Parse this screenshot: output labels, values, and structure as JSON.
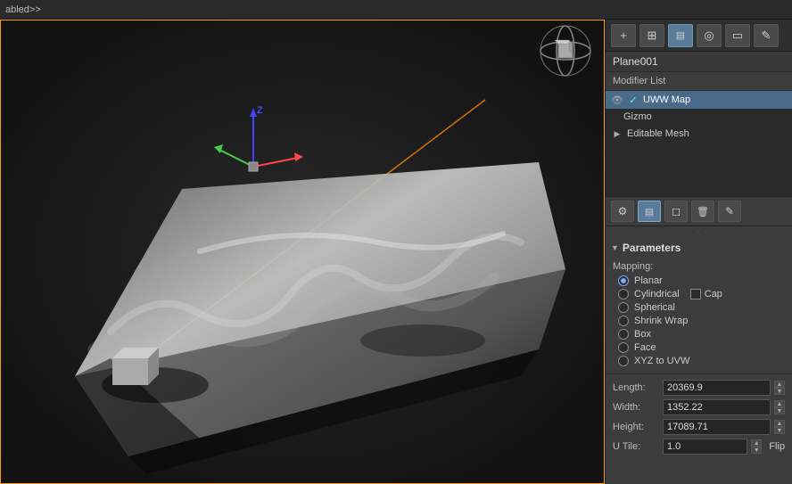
{
  "topbar": {
    "text": "abled>>"
  },
  "viewport": {
    "label": ""
  },
  "rightpanel": {
    "toolbar": {
      "plus_label": "+",
      "buttons": [
        {
          "icon": "⊞",
          "label": "modifier-list-icon",
          "active": false
        },
        {
          "icon": "▤",
          "label": "properties-icon",
          "active": true
        },
        {
          "icon": "◎",
          "label": "circle-icon",
          "active": false
        },
        {
          "icon": "▭",
          "label": "rect-icon",
          "active": false
        },
        {
          "icon": "✎",
          "label": "edit-icon",
          "active": false
        }
      ]
    },
    "object_name": "Plane001",
    "modifier_list_label": "Modifier List",
    "modifiers": [
      {
        "name": "UWW Map",
        "selected": true,
        "has_eye": true,
        "has_check": true,
        "expandable": false
      },
      {
        "name": "Gizmo",
        "selected": false,
        "has_eye": false,
        "has_check": false,
        "expandable": false,
        "sub": true
      },
      {
        "name": "Editable Mesh",
        "selected": false,
        "has_eye": false,
        "has_check": false,
        "expandable": true,
        "sub": false
      }
    ],
    "panel_buttons": [
      {
        "icon": "⚙",
        "label": "settings-icon",
        "active": false
      },
      {
        "icon": "▤",
        "label": "list-icon",
        "active": true
      },
      {
        "icon": "◻",
        "label": "box-icon",
        "active": false
      },
      {
        "icon": "🗑",
        "label": "delete-icon",
        "active": false
      },
      {
        "icon": "✎",
        "label": "edit2-icon",
        "active": false
      }
    ],
    "parameters": {
      "section_title": "Parameters",
      "mapping_label": "Mapping:",
      "mapping_options": [
        {
          "label": "Planar",
          "checked": true
        },
        {
          "label": "Cylindrical",
          "checked": false,
          "has_cap": true
        },
        {
          "label": "Spherical",
          "checked": false
        },
        {
          "label": "Shrink Wrap",
          "checked": false
        },
        {
          "label": "Box",
          "checked": false
        },
        {
          "label": "Face",
          "checked": false
        },
        {
          "label": "XYZ to UVW",
          "checked": false
        }
      ],
      "cap_label": "Cap",
      "fields": [
        {
          "label": "Length:",
          "value": "20369.9",
          "has_spinner": true
        },
        {
          "label": "Width:",
          "value": "1352.22",
          "has_spinner": true
        },
        {
          "label": "Height:",
          "value": "17089.71",
          "has_spinner": true
        },
        {
          "label": "U Tile:",
          "value": "1.0",
          "has_spinner": true
        }
      ],
      "flip_label": "Flip"
    }
  }
}
